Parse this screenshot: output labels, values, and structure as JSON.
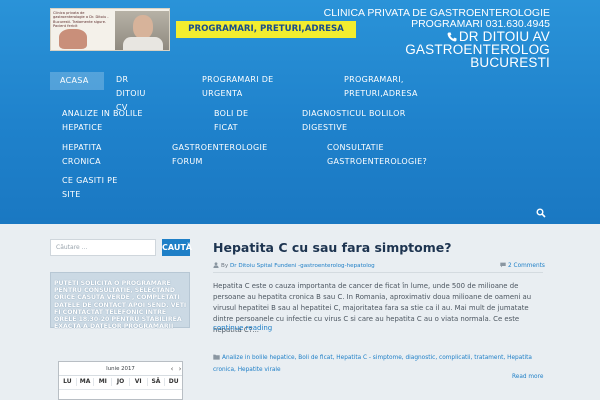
{
  "header": {
    "cta_label": "PROGRAMARI, PRETURI,ADRESA",
    "clinic_line1": "CLINICA PRIVATA DE GASTROENTEROLOGIE",
    "clinic_line2": "PROGRAMARI 031.630.4945",
    "doctor_line1": "DR DITOIU AV",
    "doctor_line2": "GASTROENTEROLOG",
    "doctor_line3": "BUCURESTI",
    "logo_text": "Clinica privata de gastroenterologie a Dr. Ditoiu - Bucuresti. Tratamente sigure. Pacient fericit"
  },
  "nav": {
    "items": [
      {
        "label": "ACASA",
        "active": true
      },
      {
        "label": "DR DITOIU CV"
      },
      {
        "label": "PROGRAMARI DE URGENTA"
      },
      {
        "label": "PROGRAMARI, PRETURI,ADRESA"
      },
      {
        "label": "ANALIZE IN BOLILE HEPATICE"
      },
      {
        "label": "BOLI DE FICAT"
      },
      {
        "label": "DIAGNOSTICUL BOLILOR DIGESTIVE"
      },
      {
        "label": "HEPATITA CRONICA"
      },
      {
        "label": "GASTROENTEROLOGIE FORUM"
      },
      {
        "label": "CONSULTATIE GASTROENTEROLOGIE?"
      },
      {
        "label": "CE GASITI PE SITE"
      }
    ]
  },
  "sidebar": {
    "search_placeholder": "Căutare ...",
    "search_button": "CAUTĂ",
    "promo_text": "PUTETI SOLICITA O PROGRAMARE PENTRU CONSULTATIE, SELECTAND ORICE CASUTA VERDE , COMPLETATI DATELE DE CONTACT APOI SEND. VETI FI CONTACTAT TELEFONIC INTRE ORELE 18.30-20 PENTRU STABILIREA EXACTA A DATELOR PROGRAMARII",
    "calendar": {
      "month": "Iunie 2017",
      "days": [
        "LU",
        "MA",
        "MI",
        "JO",
        "VI",
        "SÂ",
        "DU"
      ]
    }
  },
  "post": {
    "title": "Hepatita C cu sau fara simptome?",
    "by": "By",
    "author": "Dr Ditoiu Spital Fundeni -gastroenterolog-hepatolog",
    "comments": "2 Comments",
    "excerpt": "Hepatita C este o cauza importanta de cancer de ficat în lume, unde 500 de milioane de persoane au hepatita cronica B sau C.  In Romania, aproximativ doua milioane de oameni au virusul hepatitei B sau al hepatitei C, majoritatea fara sa stie ca il au.  Mai mult de jumatate dintre persoanele cu infectie cu virus C si care au hepatita C au o viata normala. Ce este hepatita C?...",
    "continue": "continue reading",
    "tags": "Analize in bolile hepatice, Boli de ficat, Hepatita C - simptome, diagnostic, complicatii, tratament, Hepatita cronica, Hepatite virale",
    "readmore": "Read more"
  },
  "colors": {
    "header_blue": "#1f82cc",
    "cta_yellow": "#f2ed2f",
    "link_blue": "#1e7fc7",
    "title_dark": "#1d3450"
  },
  "icons": [
    "phone-icon",
    "search-icon",
    "user-icon",
    "comment-icon",
    "tag-icon",
    "chevron-left-icon",
    "chevron-right-icon"
  ]
}
